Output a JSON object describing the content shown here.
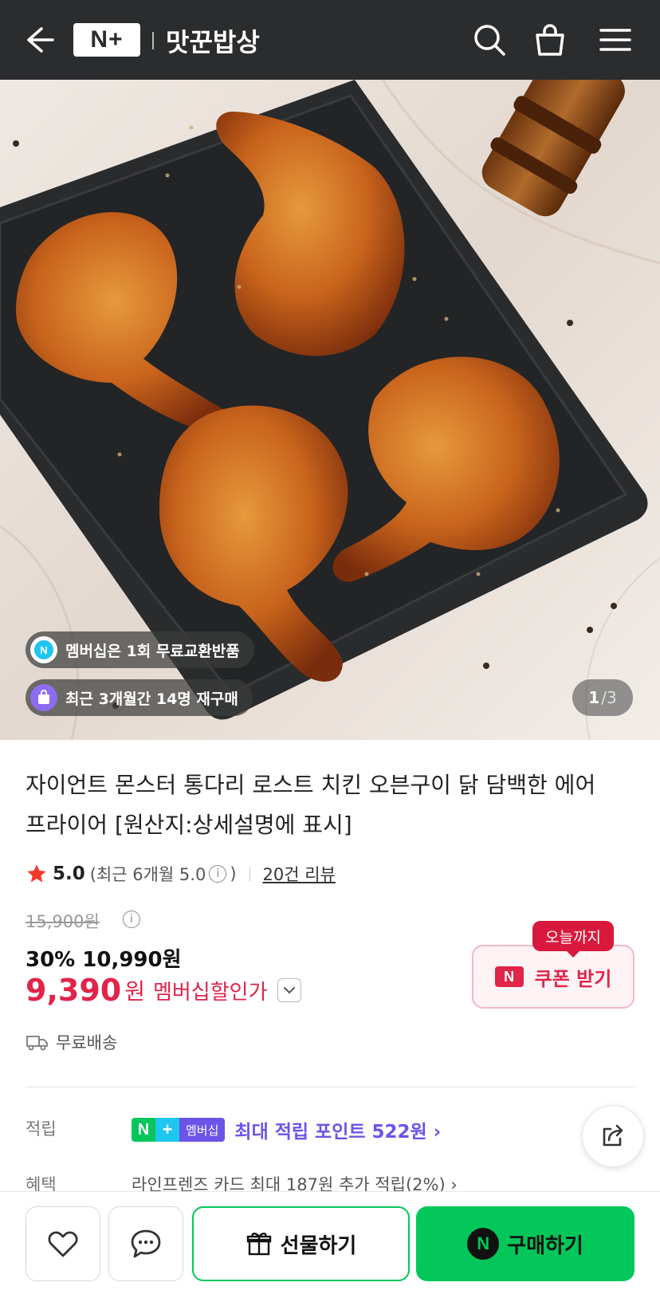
{
  "header": {
    "logo_text": "N+",
    "store_name": "맛꾼밥상"
  },
  "hero": {
    "badge_exchange": "멤버십은 1회 무료교환반품",
    "badge_repurchase": "최근 3개월간 14명 재구매",
    "counter_current": "1",
    "counter_total": "/3"
  },
  "product": {
    "title": "자이언트 몬스터 통다리 로스트 치킨 오븐구이 닭 담백한 에어프라이어 [원산지:상세설명에 표시]",
    "rating": "5.0",
    "rating_recent_prefix": "(최근 6개월 5.0",
    "rating_recent_suffix": ")",
    "review_link": "20건 리뷰",
    "original_price": "15,900원",
    "sale_line": "30% 10,990원",
    "member_price": "9,390",
    "member_won": "원",
    "member_label": "멤버십할인가",
    "shipping": "무료배송"
  },
  "coupon": {
    "tag": "오늘까지",
    "badge": "N",
    "label": "쿠폰 받기"
  },
  "points": {
    "label": "적립",
    "badge_n": "N",
    "badge_plus": "+",
    "badge_membership": "멤버십",
    "text": "최대 적립 포인트 522원 ›"
  },
  "benefit": {
    "label": "혜택",
    "text": "라인프렌즈 카드 최대 187원 추가 적립(2%) ›"
  },
  "bottom": {
    "gift_label": "선물하기",
    "buy_badge": "N",
    "buy_label": "구매하기"
  },
  "colors": {
    "header_bg": "#2b2c2e",
    "naver_green": "#03c75a",
    "sale_red": "#e0244a",
    "membership_purple": "#6b54e8"
  }
}
